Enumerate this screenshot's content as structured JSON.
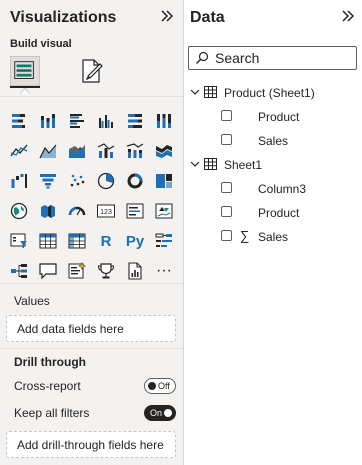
{
  "visualizations": {
    "title": "Visualizations",
    "build_visual_label": "Build visual",
    "values_label": "Values",
    "values_placeholder": "Add data fields here",
    "drill_through_label": "Drill through",
    "cross_report": {
      "label": "Cross-report",
      "state": "Off"
    },
    "keep_all_filters": {
      "label": "Keep all filters",
      "state": "On"
    },
    "drill_placeholder": "Add drill-through fields here",
    "icon_grid": [
      [
        "stacked-bar-chart-icon",
        "stacked-column-chart-icon",
        "clustered-bar-chart-icon",
        "clustered-column-chart-icon",
        "100-stacked-bar-chart-icon",
        "100-stacked-column-chart-icon"
      ],
      [
        "line-chart-icon",
        "area-chart-icon",
        "stacked-area-chart-icon",
        "line-clustered-column-chart-icon",
        "line-stacked-column-chart-icon",
        "ribbon-chart-icon"
      ],
      [
        "waterfall-chart-icon",
        "funnel-chart-icon",
        "scatter-chart-icon",
        "pie-chart-icon",
        "donut-chart-icon",
        "treemap-icon"
      ],
      [
        "map-icon",
        "filled-map-icon",
        "gauge-icon",
        "card-icon",
        "multi-row-card-icon",
        "kpi-icon"
      ],
      [
        "slicer-icon",
        "table-icon",
        "matrix-icon",
        "r-script-visual-icon",
        "python-visual-icon",
        "key-influencers-icon"
      ],
      [
        "decomposition-tree-icon",
        "qa-icon",
        "smart-narrative-icon",
        "metrics-icon",
        "paginated-report-icon",
        "more-visuals-icon"
      ]
    ],
    "text_glyphs": {
      "card": "123",
      "r": "R",
      "python": "Py",
      "more": "···"
    }
  },
  "data_pane": {
    "title": "Data",
    "search_placeholder": "Search",
    "tables": [
      {
        "name": "Product (Sheet1)",
        "fields": [
          {
            "name": "Product",
            "sum": false
          },
          {
            "name": "Sales",
            "sum": false
          }
        ]
      },
      {
        "name": "Sheet1",
        "fields": [
          {
            "name": "Column3",
            "sum": false
          },
          {
            "name": "Product",
            "sum": false
          },
          {
            "name": "Sales",
            "sum": true
          }
        ]
      }
    ],
    "sigma_glyph": "∑"
  },
  "colors": {
    "accent_teal": "#1b8a7a",
    "dark": "#252423",
    "blue": "#1e6fb4",
    "yellow": "#f2c811",
    "gray_bg": "#f3f2f1"
  }
}
